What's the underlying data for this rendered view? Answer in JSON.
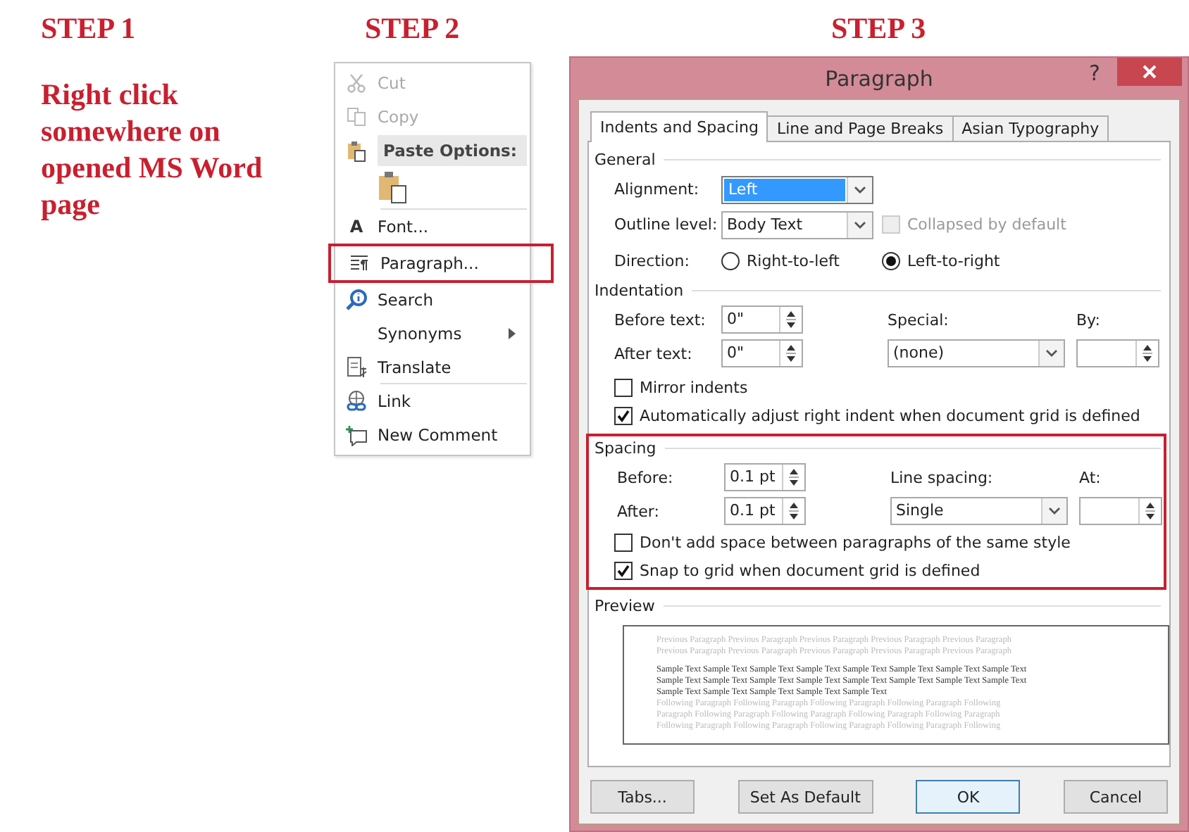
{
  "steps": [
    {
      "title": "STEP 1",
      "text": "Right click somewhere on opened MS Word page"
    },
    {
      "title": "STEP 2"
    },
    {
      "title": "STEP 3"
    }
  ],
  "context_menu": {
    "items": [
      {
        "kind": "command",
        "label": "Cut",
        "disabled": true,
        "highlighted": false,
        "separator_after": false
      },
      {
        "kind": "command",
        "label": "Copy",
        "disabled": true,
        "highlighted": false,
        "separator_after": false
      },
      {
        "kind": "header",
        "label": "Paste Options:",
        "disabled": false,
        "highlighted": false,
        "separator_after": false
      },
      {
        "kind": "paste-button",
        "disabled": false,
        "highlighted": false,
        "separator_after": true
      },
      {
        "kind": "command",
        "label": "Font...",
        "icon_text": "A",
        "disabled": false,
        "highlighted": false,
        "separator_after": false
      },
      {
        "kind": "command",
        "label": "Paragraph...",
        "disabled": false,
        "highlighted": true,
        "separator_after": false
      },
      {
        "kind": "command",
        "label": "Search",
        "disabled": false,
        "highlighted": false,
        "separator_after": false
      },
      {
        "kind": "submenu",
        "label": "Synonyms",
        "disabled": false,
        "highlighted": false,
        "separator_after": false
      },
      {
        "kind": "command",
        "label": "Translate",
        "disabled": false,
        "highlighted": false,
        "separator_after": true
      },
      {
        "kind": "command",
        "label": "Link",
        "disabled": false,
        "highlighted": false,
        "separator_after": false
      },
      {
        "kind": "command",
        "label": "New Comment",
        "disabled": false,
        "highlighted": false,
        "separator_after": false
      }
    ]
  },
  "dialog": {
    "title": "Paragraph",
    "help": "?",
    "tabs": [
      {
        "label": "Indents and Spacing",
        "selected": true
      },
      {
        "label": "Line and Page Breaks",
        "selected": false
      },
      {
        "label": "Asian Typography",
        "selected": false
      }
    ],
    "general": {
      "heading": "General",
      "alignment": {
        "label": "Alignment:",
        "value": "Left",
        "focused": true
      },
      "outline_level": {
        "label": "Outline level:",
        "value": "Body Text",
        "focused": false
      },
      "collapsed": {
        "label": "Collapsed by default",
        "checked": false,
        "disabled": true
      },
      "direction": {
        "label": "Direction:",
        "options": [
          {
            "label": "Right-to-left",
            "selected": false
          },
          {
            "label": "Left-to-right",
            "selected": true
          }
        ]
      }
    },
    "indentation": {
      "heading": "Indentation",
      "before_text": {
        "label": "Before text:",
        "value": "0\""
      },
      "after_text": {
        "label": "After text:",
        "value": "0\""
      },
      "special": {
        "label": "Special:",
        "value": "(none)"
      },
      "by": {
        "label": "By:"
      },
      "checkboxes": [
        {
          "label": "Mirror indents",
          "checked": false
        },
        {
          "label": "Automatically adjust right indent when document grid is defined",
          "checked": true
        }
      ]
    },
    "spacing": {
      "heading": "Spacing",
      "highlighted": true,
      "before": {
        "label": "Before:",
        "value": "0.1 pt"
      },
      "after": {
        "label": "After:",
        "value": "0.1 pt"
      },
      "line_spacing": {
        "label": "Line spacing:",
        "value": "Single"
      },
      "at": {
        "label": "At:"
      },
      "checkboxes": [
        {
          "label": "Don't add space between paragraphs of the same style",
          "checked": false
        },
        {
          "label": "Snap to grid when document grid is defined",
          "checked": true
        }
      ]
    },
    "preview": {
      "heading": "Preview",
      "lines": [
        {
          "kind": "previous",
          "text": "Previous Paragraph Previous Paragraph Previous Paragraph Previous Paragraph Previous Paragraph"
        },
        {
          "kind": "previous",
          "text": "Previous Paragraph Previous Paragraph Previous Paragraph Previous Paragraph Previous Paragraph"
        },
        {
          "kind": "sample",
          "text": "Sample Text Sample Text Sample Text Sample Text Sample Text Sample Text Sample Text Sample Text"
        },
        {
          "kind": "sample",
          "text": "Sample Text Sample Text Sample Text Sample Text Sample Text Sample Text Sample Text Sample Text"
        },
        {
          "kind": "sample",
          "text": "Sample Text Sample Text Sample Text Sample Text Sample Text"
        },
        {
          "kind": "following",
          "text": "Following Paragraph Following Paragraph Following Paragraph Following Paragraph Following"
        },
        {
          "kind": "following",
          "text": "Paragraph Following Paragraph Following Paragraph Following Paragraph Following Paragraph"
        },
        {
          "kind": "following",
          "text": "Following Paragraph Following Paragraph Following Paragraph Following Paragraph Following"
        }
      ]
    },
    "buttons": [
      {
        "label": "Tabs...",
        "default": false
      },
      {
        "label": "Set As Default",
        "default": false
      },
      {
        "label": "OK",
        "default": true
      },
      {
        "label": "Cancel",
        "default": false
      }
    ]
  }
}
